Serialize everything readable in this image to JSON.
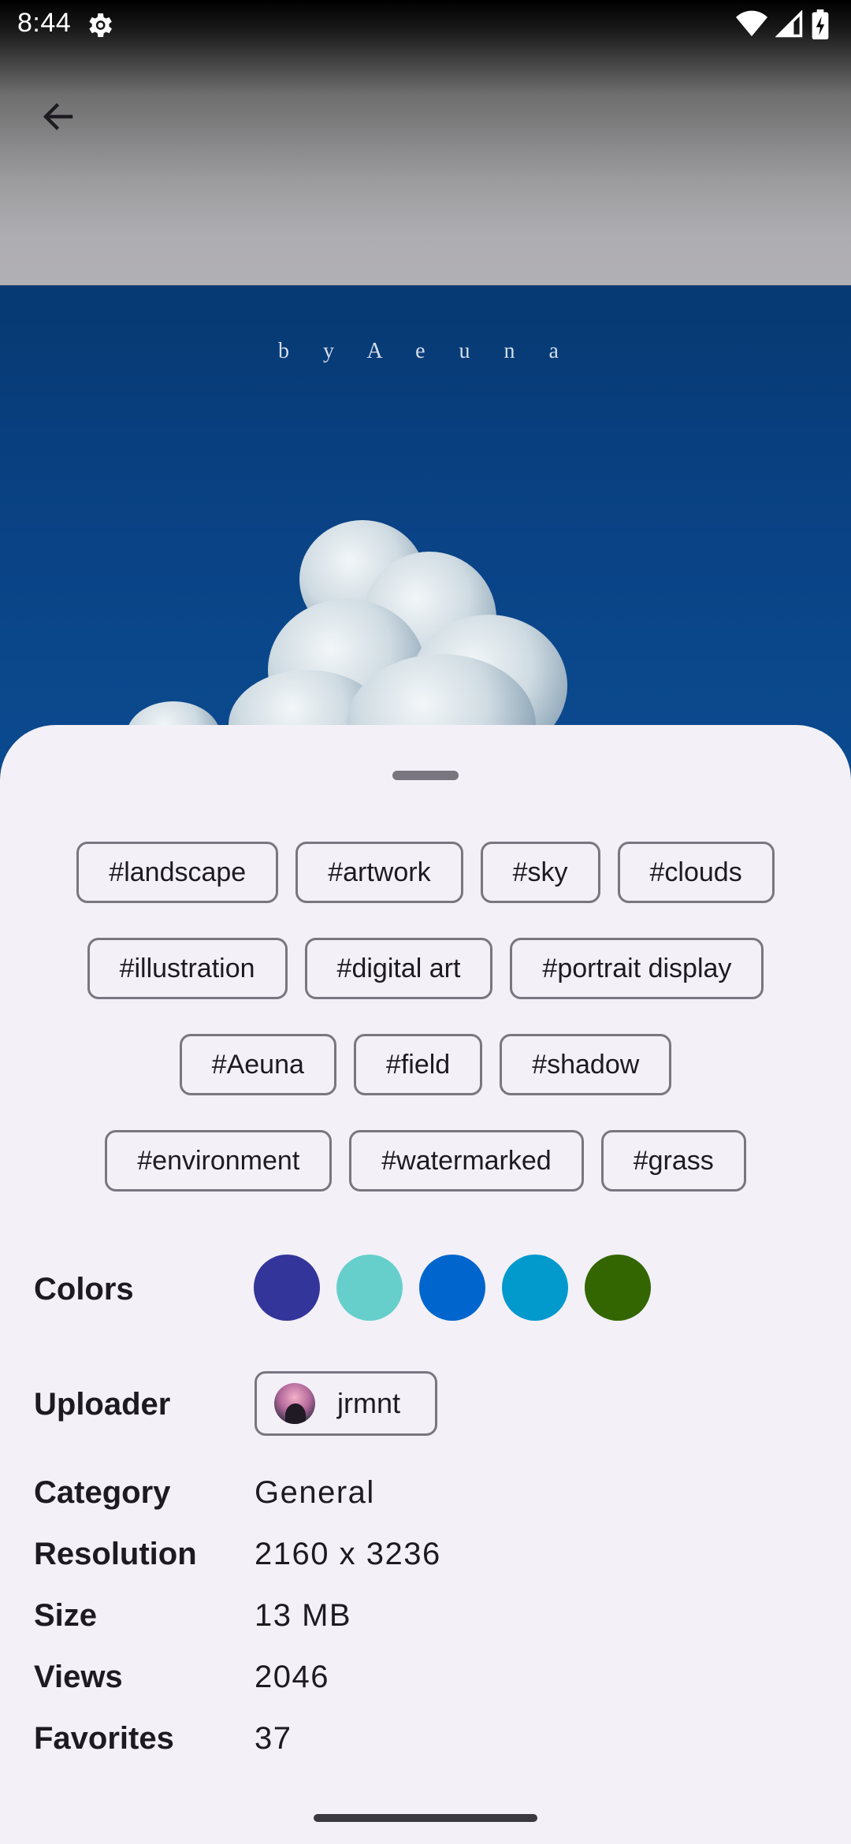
{
  "status_bar": {
    "time": "8:44",
    "icons": [
      "settings-gear-icon",
      "wifi-icon",
      "cell-signal-icon",
      "battery-charging-icon"
    ]
  },
  "app_bar": {
    "back_icon": "arrow-back-icon"
  },
  "wallpaper": {
    "watermark_text": "b y A e u n a"
  },
  "tags": [
    [
      "#landscape",
      "#artwork",
      "#sky",
      "#clouds"
    ],
    [
      "#illustration",
      "#digital art",
      "#portrait display"
    ],
    [
      "#Aeuna",
      "#field",
      "#shadow"
    ],
    [
      "#environment",
      "#watermarked",
      "#grass"
    ]
  ],
  "details": {
    "colors_label": "Colors",
    "colors": [
      "#34359b",
      "#66cfcc",
      "#0066cd",
      "#0299cd",
      "#336600"
    ],
    "uploader_label": "Uploader",
    "uploader_name": "jrmnt",
    "category_label": "Category",
    "category_value": "General",
    "resolution_label": "Resolution",
    "resolution_value": "2160 x 3236",
    "size_label": "Size",
    "size_value": "13 MB",
    "views_label": "Views",
    "views_value": "2046",
    "favorites_label": "Favorites",
    "favorites_value": "37"
  }
}
